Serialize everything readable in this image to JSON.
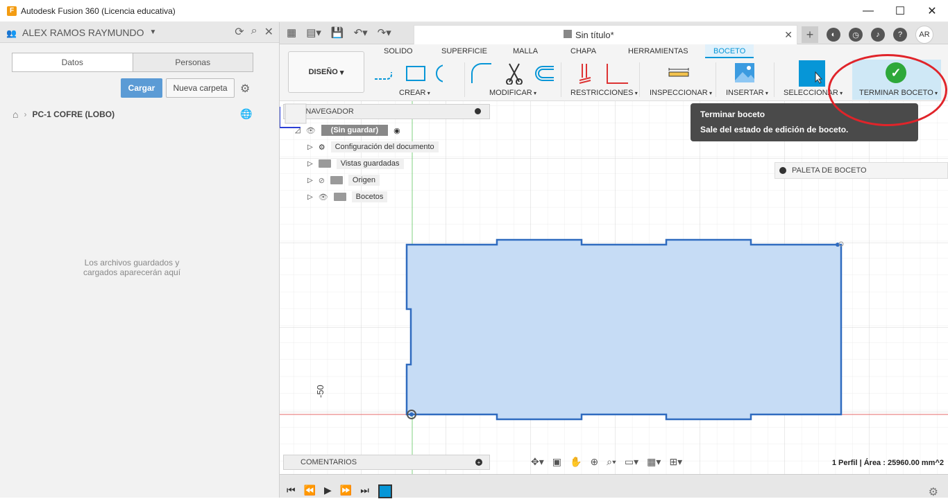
{
  "window": {
    "title": "Autodesk Fusion 360 (Licencia educativa)"
  },
  "datapanel": {
    "user": "ALEX RAMOS RAYMUNDO",
    "tabs": [
      "Datos",
      "Personas"
    ],
    "upload": "Cargar",
    "new_folder": "Nueva carpeta",
    "project": "PC-1 COFRE (LOBO)",
    "empty_line1": "Los archivos guardados y",
    "empty_line2": "cargados aparecerán aquí"
  },
  "document": {
    "tab_title": "Sin título*"
  },
  "appbar": {
    "avatar": "AR"
  },
  "ribbon": {
    "workspace": "DISEÑO",
    "tabs": [
      "SOLIDO",
      "SUPERFICIE",
      "MALLA",
      "CHAPA",
      "HERRAMIENTAS",
      "BOCETO"
    ],
    "groups": [
      "CREAR",
      "MODIFICAR",
      "RESTRICCIONES",
      "INSPECCIONAR",
      "INSERTAR",
      "SELECCIONAR",
      "TERMINAR BOCETO"
    ]
  },
  "tooltip": {
    "title": "Terminar boceto",
    "description": "Sale del estado de edición de boceto."
  },
  "navigator": {
    "title": "NAVEGADOR",
    "root": "(Sin guardar)",
    "items": [
      "Configuración del documento",
      "Vistas guardadas",
      "Origen",
      "Bocetos"
    ]
  },
  "palette": {
    "title": "PALETA DE BOCETO"
  },
  "comments": {
    "title": "COMENTARIOS"
  },
  "canvas": {
    "axis_tick": "-50"
  },
  "status": {
    "profile": "1 Perfil | Área : 25960.00 mm^2"
  },
  "colors": {
    "accent": "#0696d7",
    "sketch_fill": "#c6dcf5",
    "sketch_stroke": "#2f6bbf",
    "finish_green": "#2ea83a",
    "highlight": "#e0242a"
  }
}
